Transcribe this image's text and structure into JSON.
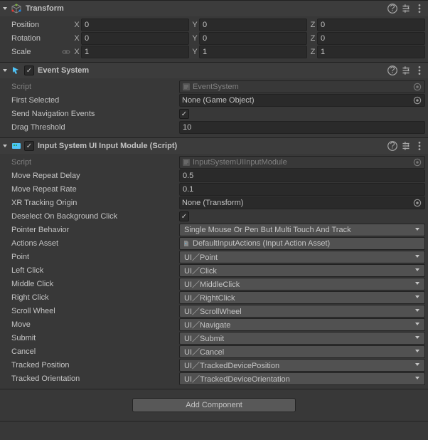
{
  "transform": {
    "title": "Transform",
    "position": {
      "label": "Position",
      "x": "0",
      "y": "0",
      "z": "0"
    },
    "rotation": {
      "label": "Rotation",
      "x": "0",
      "y": "0",
      "z": "0"
    },
    "scale": {
      "label": "Scale",
      "x": "1",
      "y": "1",
      "z": "1"
    }
  },
  "eventSystem": {
    "title": "Event System",
    "script": {
      "label": "Script",
      "value": "EventSystem"
    },
    "firstSelected": {
      "label": "First Selected",
      "value": "None (Game Object)"
    },
    "sendNav": {
      "label": "Send Navigation Events"
    },
    "dragThreshold": {
      "label": "Drag Threshold",
      "value": "10"
    }
  },
  "inputModule": {
    "title": "Input System UI Input Module (Script)",
    "script": {
      "label": "Script",
      "value": "InputSystemUIInputModule"
    },
    "moveRepeatDelay": {
      "label": "Move Repeat Delay",
      "value": "0.5"
    },
    "moveRepeatRate": {
      "label": "Move Repeat Rate",
      "value": "0.1"
    },
    "xrTracking": {
      "label": "XR Tracking Origin",
      "value": "None (Transform)"
    },
    "deselect": {
      "label": "Deselect On Background Click"
    },
    "pointerBehavior": {
      "label": "Pointer Behavior",
      "value": "Single Mouse Or Pen But Multi Touch And Track"
    },
    "actionsAsset": {
      "label": "Actions Asset",
      "value": "DefaultInputActions (Input Action Asset)"
    },
    "point": {
      "label": "Point",
      "value": "UI／Point"
    },
    "leftClick": {
      "label": "Left Click",
      "value": "UI／Click"
    },
    "middleClick": {
      "label": "Middle Click",
      "value": "UI／MiddleClick"
    },
    "rightClick": {
      "label": "Right Click",
      "value": "UI／RightClick"
    },
    "scrollWheel": {
      "label": "Scroll Wheel",
      "value": "UI／ScrollWheel"
    },
    "move": {
      "label": "Move",
      "value": "UI／Navigate"
    },
    "submit": {
      "label": "Submit",
      "value": "UI／Submit"
    },
    "cancel": {
      "label": "Cancel",
      "value": "UI／Cancel"
    },
    "trackedPos": {
      "label": "Tracked Position",
      "value": "UI／TrackedDevicePosition"
    },
    "trackedOri": {
      "label": "Tracked Orientation",
      "value": "UI／TrackedDeviceOrientation"
    }
  },
  "addComponent": "Add Component",
  "axes": {
    "x": "X",
    "y": "Y",
    "z": "Z"
  }
}
